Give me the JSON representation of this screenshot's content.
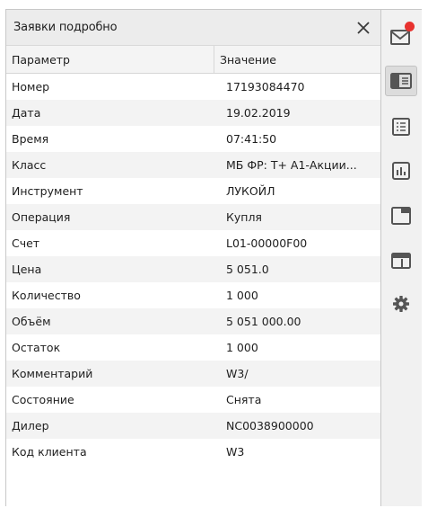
{
  "panel": {
    "title": "Заявки подробно",
    "columns": {
      "param": "Параметр",
      "value": "Значение"
    },
    "rows": [
      {
        "param": "Номер",
        "value": "17193084470"
      },
      {
        "param": "Дата",
        "value": "19.02.2019"
      },
      {
        "param": "Время",
        "value": "07:41:50"
      },
      {
        "param": "Класс",
        "value": "МБ ФР: Т+ А1-Акции..."
      },
      {
        "param": "Инструмент",
        "value": "ЛУКОЙЛ"
      },
      {
        "param": "Операция",
        "value": "Купля"
      },
      {
        "param": "Счет",
        "value": "L01-00000F00"
      },
      {
        "param": "Цена",
        "value": "5 051.0"
      },
      {
        "param": "Количество",
        "value": "1 000"
      },
      {
        "param": "Объём",
        "value": "5 051 000.00"
      },
      {
        "param": "Остаток",
        "value": "1 000"
      },
      {
        "param": "Комментарий",
        "value": "W3/"
      },
      {
        "param": "Состояние",
        "value": "Снята"
      },
      {
        "param": "Дилер",
        "value": "NC0038900000"
      },
      {
        "param": "Код клиента",
        "value": "W3"
      }
    ]
  },
  "sidebar": {
    "items": [
      {
        "icon": "mail-notification-icon",
        "active": false,
        "badge": true
      },
      {
        "icon": "order-details-icon",
        "active": true
      },
      {
        "icon": "list-icon",
        "active": false
      },
      {
        "icon": "bar-chart-icon",
        "active": false
      },
      {
        "icon": "window-icon",
        "active": false
      },
      {
        "icon": "panel-layout-icon",
        "active": false
      },
      {
        "icon": "gear-icon",
        "active": false
      }
    ]
  },
  "colors": {
    "badge": "#e8322f",
    "icon": "#555555",
    "active_bg": "#dcdcdc"
  }
}
